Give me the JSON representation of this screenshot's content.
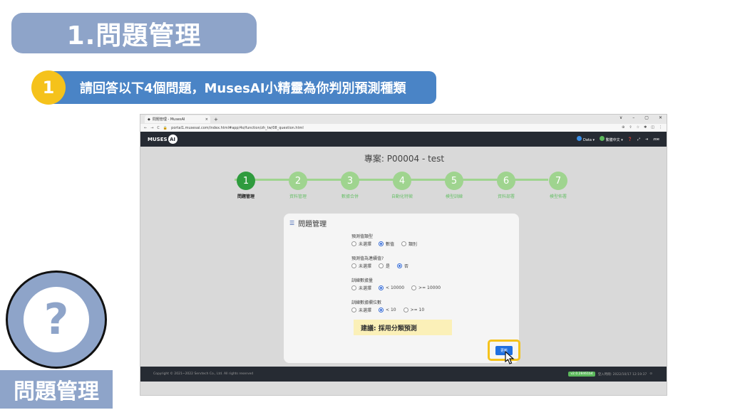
{
  "slide": {
    "title": "1.問題管理",
    "step_number": "1",
    "step_text": "請回答以下4個問題，MusesAI小精靈為你判別預測種類",
    "help_mark": "?",
    "help_label": "問題管理"
  },
  "browser": {
    "tab_title": "問題管理 - MusesAI",
    "tab_close": "×",
    "new_tab": "+",
    "url": "portal1.musesai.com/index.html#app/4o/function/zh_tw/08_question.html",
    "window_controls": [
      "∨",
      "–",
      "▢",
      "✕"
    ]
  },
  "app": {
    "logo_text": "MUSES",
    "logo_ai": "AI",
    "nav": {
      "data_menu": "Data",
      "language": "繁體中文",
      "user": "zoe"
    },
    "project_title": "專案: P00004 - test",
    "steps": [
      {
        "num": "1",
        "label": "問題管理"
      },
      {
        "num": "2",
        "label": "資料管理"
      },
      {
        "num": "3",
        "label": "數據合併"
      },
      {
        "num": "4",
        "label": "自動化特徵"
      },
      {
        "num": "5",
        "label": "模型訓練"
      },
      {
        "num": "6",
        "label": "資料部署"
      },
      {
        "num": "7",
        "label": "模型佈署"
      }
    ],
    "card": {
      "title": "問題管理",
      "questions": [
        {
          "label": "預測值類型",
          "options": [
            "未選擇",
            "數值",
            "類別"
          ],
          "selected": 1
        },
        {
          "label": "預測值為連續值?",
          "options": [
            "未選擇",
            "是",
            "否"
          ],
          "selected": 2
        },
        {
          "label": "訓練數據量",
          "options": [
            "未選擇",
            "< 10000",
            ">= 10000"
          ],
          "selected": 1
        },
        {
          "label": "訓練數據欄位數",
          "options": [
            "未選擇",
            "< 10",
            ">= 10"
          ],
          "selected": 1
        }
      ],
      "suggestion": "建議: 採用分類預測",
      "update_button": "更新"
    },
    "footer": {
      "copyright": "Copyright © 2021~2022 Servtech Co., Ltd. All rights reserved",
      "version": "v2.0.28461b4",
      "login_time": "登入時間: 2022/10/17 12:19:37"
    }
  },
  "colors": {
    "title_bg": "#8ea4c9",
    "step_bar": "#4a84c6",
    "badge": "#f5c21b",
    "active_step": "#2f9b3e",
    "inactive_step": "#9fd48f",
    "nav_bg": "#262b33",
    "button": "#1f6fe0"
  }
}
